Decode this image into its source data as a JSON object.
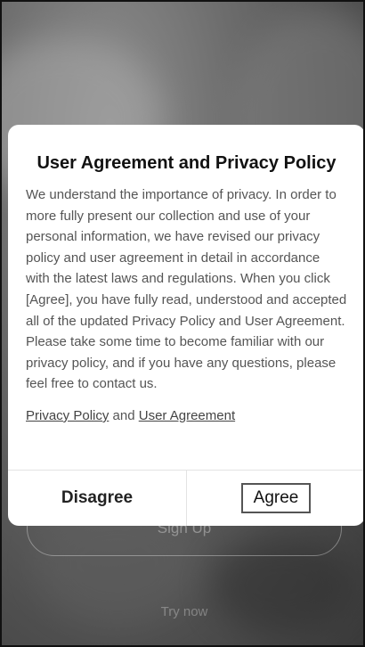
{
  "background": {
    "signup_label": "Sign Up",
    "try_label": "Try now"
  },
  "dialog": {
    "title": "User Agreement and Privacy Policy",
    "body": "We understand the importance of privacy. In order to more fully present our collection and use of your personal information, we have revised our privacy policy and user agreement in detail in accordance with the latest laws and regulations. When you click [Agree], you have fully read, understood and accepted all of the updated Privacy Policy and User Agreement. Please take some time to become familiar with our privacy policy, and if you have any questions, please feel free to contact us.",
    "privacy_link": "Privacy Policy",
    "and_text": " and ",
    "agreement_link": "User Agreement",
    "disagree_label": "Disagree",
    "agree_label": "Agree"
  },
  "colors": {
    "overlay": "#5a5a5a",
    "dialog_bg": "#ffffff",
    "text": "#555555",
    "title": "#111111"
  }
}
